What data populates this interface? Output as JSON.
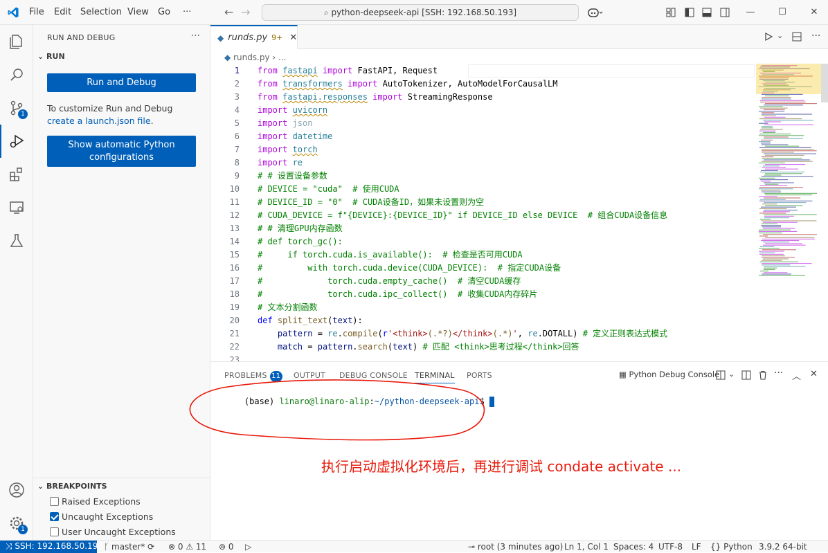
{
  "titlebar": {
    "menus": [
      "File",
      "Edit",
      "Selection",
      "View",
      "Go",
      "···"
    ],
    "command_center": "python-deepseek-api [SSH: 192.168.50.193]"
  },
  "activity_bar": {
    "items": [
      {
        "name": "explorer-icon"
      },
      {
        "name": "search-icon"
      },
      {
        "name": "source-control-icon",
        "badge": "1"
      },
      {
        "name": "run-debug-icon",
        "active": true
      },
      {
        "name": "extensions-icon"
      },
      {
        "name": "remote-explorer-icon"
      },
      {
        "name": "testing-icon"
      }
    ],
    "accounts_badge": "1"
  },
  "sidebar": {
    "title": "RUN AND DEBUG",
    "more": "···",
    "section_run": "RUN",
    "run_button": "Run and Debug",
    "customize_text": "To customize Run and Debug ",
    "customize_link": "create a launch.json file",
    "customize_end": ".",
    "python_button": "Show automatic Python configurations",
    "breakpoints_title": "BREAKPOINTS",
    "breakpoints": [
      {
        "label": "Raised Exceptions",
        "checked": false
      },
      {
        "label": "Uncaught Exceptions",
        "checked": true
      },
      {
        "label": "User Uncaught Exceptions",
        "checked": false
      }
    ]
  },
  "editor": {
    "tab_name": "runds.py",
    "tab_badge": "9+",
    "breadcrumb": "runds.py  ›  ...",
    "lines": [
      {
        "n": "1",
        "parts": [
          [
            "kw",
            "from "
          ],
          [
            "md squig",
            "fastapi"
          ],
          [
            "kw",
            " import "
          ],
          [
            "plain",
            "FastAPI, Request"
          ]
        ]
      },
      {
        "n": "2",
        "parts": [
          [
            "kw",
            "from "
          ],
          [
            "md squig",
            "transformers"
          ],
          [
            "kw",
            " import "
          ],
          [
            "plain",
            "AutoTokenizer, AutoModelForCausalLM"
          ]
        ]
      },
      {
        "n": "3",
        "parts": [
          [
            "kw",
            "from "
          ],
          [
            "md squig",
            "fastapi.responses"
          ],
          [
            "kw",
            " import "
          ],
          [
            "plain",
            "StreamingResponse"
          ]
        ]
      },
      {
        "n": "4",
        "parts": [
          [
            "kw",
            "import "
          ],
          [
            "md squig",
            "uvicorn"
          ]
        ]
      },
      {
        "n": "5",
        "parts": [
          [
            "kw",
            "import "
          ],
          [
            "dim",
            "json"
          ]
        ]
      },
      {
        "n": "6",
        "parts": [
          [
            "kw",
            "import "
          ],
          [
            "md",
            "datetime"
          ]
        ]
      },
      {
        "n": "7",
        "parts": [
          [
            "kw",
            "import "
          ],
          [
            "md squig",
            "torch"
          ]
        ]
      },
      {
        "n": "8",
        "parts": [
          [
            "kw",
            "import "
          ],
          [
            "md",
            "re"
          ]
        ]
      },
      {
        "n": "9",
        "parts": [
          [
            "cm",
            "# # 设置设备参数"
          ]
        ]
      },
      {
        "n": "10",
        "parts": [
          [
            "cm",
            "# DEVICE = \"cuda\"  # 使用CUDA"
          ]
        ]
      },
      {
        "n": "11",
        "parts": [
          [
            "cm",
            "# DEVICE_ID = \"0\"  # CUDA设备ID，如果未设置则为空"
          ]
        ]
      },
      {
        "n": "12",
        "parts": [
          [
            "cm",
            "# CUDA_DEVICE = f\"{DEVICE}:{DEVICE_ID}\" if DEVICE_ID else DEVICE  # 组合CUDA设备信息"
          ]
        ]
      },
      {
        "n": "13",
        "parts": [
          [
            "cm",
            "# # 清理GPU内存函数"
          ]
        ]
      },
      {
        "n": "14",
        "parts": [
          [
            "cm",
            "# def torch_gc():"
          ]
        ]
      },
      {
        "n": "15",
        "parts": [
          [
            "cm",
            "#     if torch.cuda.is_available():  # 检查是否可用CUDA"
          ]
        ]
      },
      {
        "n": "16",
        "parts": [
          [
            "cm",
            "#         with torch.cuda.device(CUDA_DEVICE):  # 指定CUDA设备"
          ]
        ]
      },
      {
        "n": "17",
        "parts": [
          [
            "cm",
            "#             torch.cuda.empty_cache()  # 清空CUDA缓存"
          ]
        ]
      },
      {
        "n": "18",
        "parts": [
          [
            "cm",
            "#             torch.cuda.ipc_collect()  # 收集CUDA内存碎片"
          ]
        ]
      },
      {
        "n": "19",
        "parts": [
          [
            "cm",
            "# 文本分割函数"
          ]
        ]
      },
      {
        "n": "20",
        "parts": [
          [
            "kw2",
            "def "
          ],
          [
            "fn",
            "split_text"
          ],
          [
            "plain",
            "("
          ],
          [
            "var",
            "text"
          ],
          [
            "plain",
            "):"
          ]
        ]
      },
      {
        "n": "21",
        "parts": [
          [
            "var",
            "    pattern"
          ],
          [
            "plain",
            " = "
          ],
          [
            "md",
            "re"
          ],
          [
            "plain",
            "."
          ],
          [
            "fn",
            "compile"
          ],
          [
            "plain",
            "("
          ],
          [
            "kw2",
            "r"
          ],
          [
            "str",
            "'<think>"
          ],
          [
            "fn",
            "(.*?)"
          ],
          [
            "str",
            "</think>"
          ],
          [
            "fn",
            "(.*)"
          ],
          [
            "str",
            "'"
          ],
          [
            "plain",
            ", "
          ],
          [
            "md",
            "re"
          ],
          [
            "plain",
            ".DOTALL) "
          ],
          [
            "cm",
            "# 定义正则表达式模式"
          ]
        ]
      },
      {
        "n": "22",
        "parts": [
          [
            "var",
            "    match"
          ],
          [
            "plain",
            " = "
          ],
          [
            "var",
            "pattern"
          ],
          [
            "plain",
            "."
          ],
          [
            "fn",
            "search"
          ],
          [
            "plain",
            "("
          ],
          [
            "var",
            "text"
          ],
          [
            "plain",
            ") "
          ],
          [
            "cm",
            "# 匹配 <think>思考过程</think>回答"
          ]
        ]
      },
      {
        "n": "23",
        "parts": []
      }
    ]
  },
  "panel": {
    "tabs": [
      "PROBLEMS",
      "OUTPUT",
      "DEBUG CONSOLE",
      "TERMINAL",
      "PORTS"
    ],
    "problems_badge": "11",
    "console_select": "Python Debug Console",
    "terminal": {
      "prompt": "(base) ",
      "user_host": "linaro@linaro-alip",
      "sep": ":",
      "path": "~/python-deepseek-api",
      "dollar": "$ "
    }
  },
  "annotation": "执行启动虚拟化环境后，再进行调试 condate activate ...",
  "statusbar": {
    "remote": "SSH: 192.168.50.193",
    "branch": "master*",
    "errors": "0",
    "warnings": "11",
    "ports": "0",
    "blame": "root (3 minutes ago)",
    "position": "Ln 1, Col 1",
    "spaces": "Spaces: 4",
    "encoding": "UTF-8",
    "eol": "LF",
    "language": "Python",
    "interpreter": "3.9.2 64-bit"
  },
  "colors": {
    "accent": "#005fb8",
    "annotation": "#e8190a"
  }
}
